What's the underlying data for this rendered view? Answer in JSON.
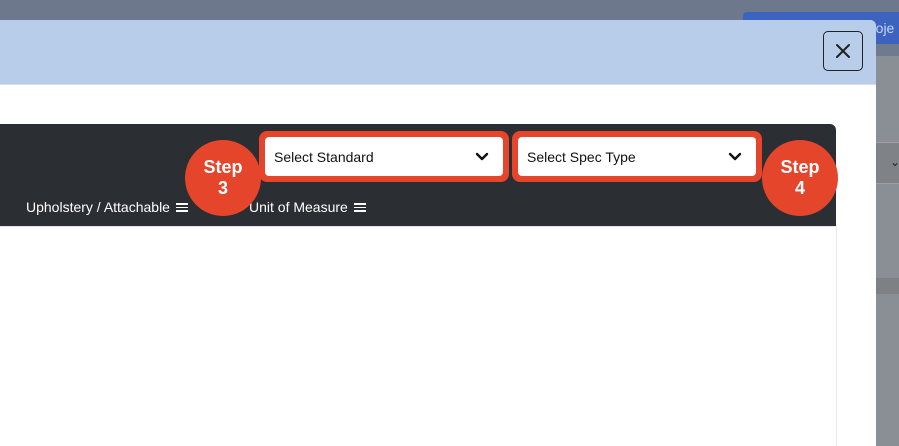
{
  "background": {
    "project_button_label": "roje"
  },
  "modal": {
    "close_symbol": "×"
  },
  "table": {
    "columns": [
      {
        "label": "Upholstery / Attachable"
      },
      {
        "label": "Unit of Measure"
      }
    ]
  },
  "filters": {
    "standard": {
      "label": "Select Standard"
    },
    "spec_type": {
      "label": "Select Spec Type"
    }
  },
  "steps": [
    {
      "word": "Step",
      "number": "3"
    },
    {
      "word": "Step",
      "number": "4"
    }
  ],
  "colors": {
    "accent": "#e5452b",
    "header_dark": "#2b2e33",
    "modal_header": "#b8cde9"
  },
  "icons": {
    "close": "close-icon",
    "dropdown": "chevron-down-icon",
    "column_menu": "menu-icon"
  }
}
